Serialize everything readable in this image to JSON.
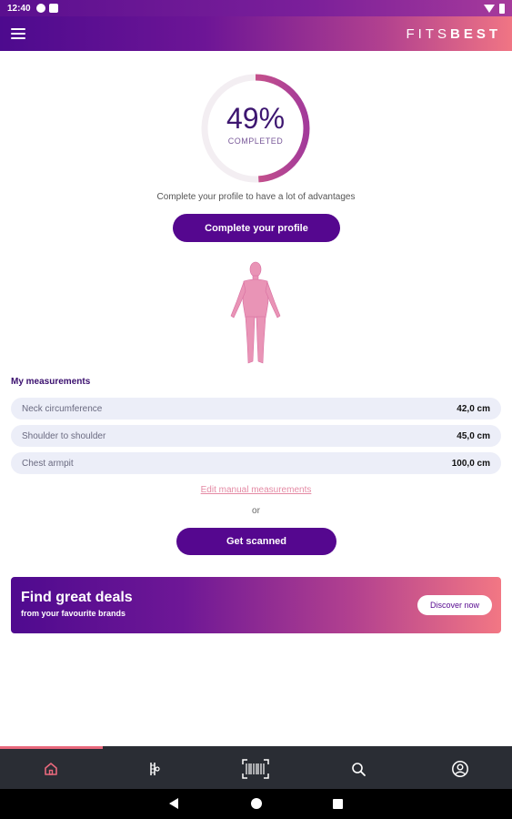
{
  "status_bar": {
    "time": "12:40"
  },
  "app_bar": {
    "brand_light": "FITS",
    "brand_bold": "BEST"
  },
  "profile": {
    "percent_label": "49%",
    "percent_value": 49,
    "completed_label": "COMPLETED",
    "hint": "Complete your profile to have a lot of advantages",
    "button_label": "Complete your profile"
  },
  "measurements": {
    "title": "My measurements",
    "rows": [
      {
        "label": "Neck circumference",
        "value": "42,0 cm"
      },
      {
        "label": "Shoulder to shoulder",
        "value": "45,0 cm"
      },
      {
        "label": "Chest armpit",
        "value": "100,0 cm"
      }
    ],
    "edit_link": "Edit manual measurements",
    "or_text": "or",
    "scan_button": "Get scanned"
  },
  "deals": {
    "title": "Find great deals",
    "subtitle": "from your favourite brands",
    "button": "Discover now"
  },
  "bottom_nav": {
    "items": [
      {
        "icon": "home-icon",
        "active": true
      },
      {
        "icon": "tailor-icon",
        "active": false
      },
      {
        "icon": "scan-icon",
        "active": false
      },
      {
        "icon": "search-icon",
        "active": false
      },
      {
        "icon": "profile-icon",
        "active": false
      }
    ]
  },
  "colors": {
    "primary": "#55078f",
    "accent": "#e8697c",
    "ring_track": "#f3eef2",
    "nav_bg": "#2a2d34"
  }
}
